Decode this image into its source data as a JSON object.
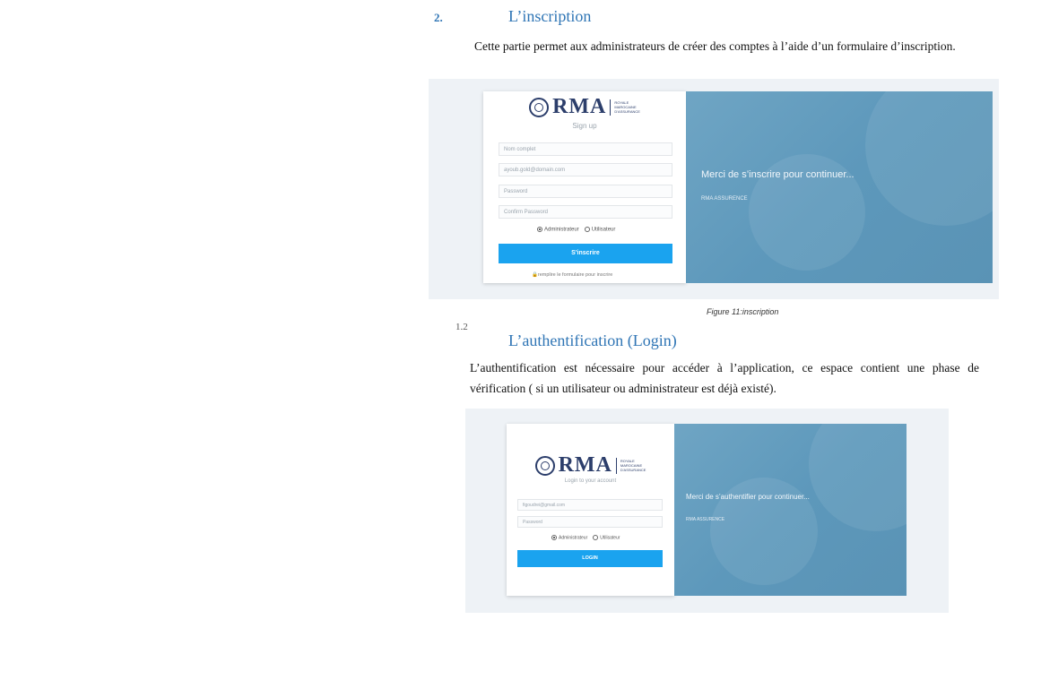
{
  "section2": {
    "number": "2.",
    "title": "L’inscription",
    "paragraph": "Cette partie permet aux administrateurs de créer des comptes à l’aide d’un formulaire d’inscription."
  },
  "signup_shot": {
    "logo_word": "RMA",
    "logo_small": [
      "ROYALE",
      "MAROCAINE",
      "D'ASSURANCE"
    ],
    "subtitle": "Sign up",
    "fields": {
      "name": "Nom complet",
      "email": "ayoub.gold@domain.com",
      "password": "Password",
      "confirm": "Confirm Password"
    },
    "radio_admin": "Administrateur",
    "radio_user": "Utilisateur",
    "button": "S'inscrire",
    "hint": "remplire le formulaire pour inscrire",
    "panel_title": "Merci de s’inscrire pour continuer...",
    "panel_sub": "RMA ASSURENCE"
  },
  "figure_caption": "Figure 11:inscription",
  "section12": {
    "number": "1.2",
    "title": "L’authentification (Login)",
    "paragraph": "L’authentification est nécessaire pour accéder à l’application, ce espace contient une phase de vérification ( si un utilisateur ou administrateur est déjà existé)."
  },
  "login_shot": {
    "logo_word": "RMA",
    "logo_small": [
      "ROYALE",
      "MAROCAINE",
      "D'ASSURANCE"
    ],
    "subtitle": "Login to your account",
    "fields": {
      "email": "figoudrei@gmail.com",
      "password": "Password"
    },
    "radio_admin": "Administrateur",
    "radio_user": "Utilisateur",
    "button": "LOGIN",
    "panel_title": "Merci de s’authentifier pour continuer...",
    "panel_sub": "RMA ASSURENCE"
  }
}
